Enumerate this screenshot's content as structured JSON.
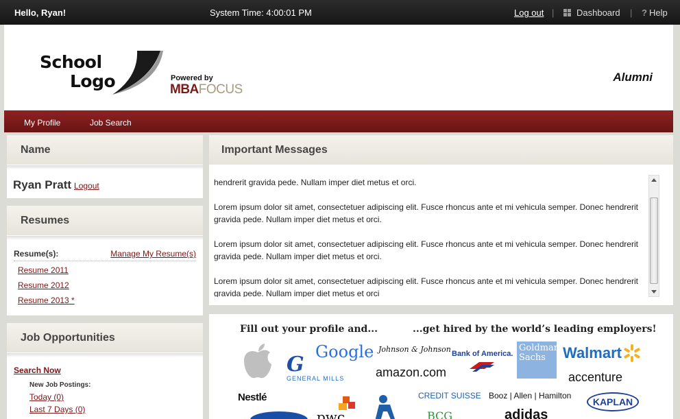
{
  "topbar": {
    "greeting": "Hello, Ryan!",
    "system_time": "System Time: 4:00:01 PM",
    "logout": "Log out",
    "dashboard": "Dashboard",
    "help": "Help",
    "help_glyph": "?"
  },
  "header": {
    "school_logo_line1": "School",
    "school_logo_line2": "Logo",
    "powered_by": "Powered by",
    "mba": "MBA",
    "focus": "FOCUS",
    "alumni": "Alumni"
  },
  "nav": {
    "items": [
      "My Profile",
      "Job Search"
    ]
  },
  "name_panel": {
    "title": "Name",
    "name": "Ryan Pratt",
    "logout": "Logout"
  },
  "resumes_panel": {
    "title": "Resumes",
    "label": "Resume(s):",
    "manage": "Manage My Resume(s)",
    "items": [
      "Resume 2011",
      "Resume 2012",
      "Resume 2013 *"
    ]
  },
  "jobs_panel": {
    "title": "Job Opportunities",
    "search_now": "Search Now",
    "new_postings": "New Job Postings:",
    "items": [
      "Today (0)",
      "Last 7 Days (0)"
    ]
  },
  "messages_panel": {
    "title": "Important Messages",
    "paragraphs": [
      "hendrerit gravida pede. Nullam imper diet metus et orci.",
      "Lorem ipsum dolor sit amet, consectetuer adipiscing elit. Fusce rhoncus ante et mi vehicula semper. Donec hendrerit gravida pede. Nullam imper diet metus et orci.",
      "Lorem ipsum dolor sit amet, consectetuer adipiscing elit. Fusce rhoncus ante et mi vehicula semper. Donec hendrerit gravida pede. Nullam imper diet metus et orci.",
      "Lorem ipsum dolor sit amet, consectetuer adipiscing elit. Fusce rhoncus ante et mi vehicula semper. Donec hendrerit gravida pede. Nullam imper diet metus et orci"
    ]
  },
  "banner": {
    "left_text": "Fill out your profile and...",
    "right_text": "...get hired by the world’s leading employers!",
    "logos": {
      "google": "Google",
      "jnj": "Johnson & Johnson",
      "bofa": "Bank of America.",
      "goldman": "Goldman Sachs",
      "walmart": "Walmart",
      "general_mills": "GENERAL MILLS",
      "amazon": "amazon.com",
      "accenture": "accenture",
      "nestle": "Nestlé",
      "credit_suisse": "CREDIT SUISSE",
      "booz": "Booz | Allen | Hamilton",
      "kaplan": "KAPLAN",
      "pwc": "pwc",
      "bcg": "BCG",
      "adidas": "adidas"
    }
  }
}
